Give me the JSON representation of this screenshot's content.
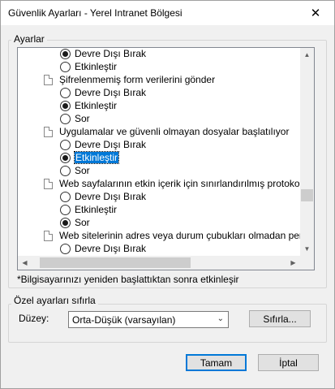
{
  "window": {
    "title": "Güvenlik Ayarları - Yerel Intranet Bölgesi",
    "close_glyph": "✕"
  },
  "settings_group": {
    "legend": "Ayarlar",
    "rows": [
      {
        "type": "radio",
        "level": 2,
        "checked": true,
        "label": "Devre Dışı Bırak"
      },
      {
        "type": "radio",
        "level": 2,
        "checked": false,
        "label": "Etkinleştir"
      },
      {
        "type": "setting",
        "level": 1,
        "label": "Şifrelenmemiş form verilerini gönder"
      },
      {
        "type": "radio",
        "level": 2,
        "checked": false,
        "label": "Devre Dışı Bırak"
      },
      {
        "type": "radio",
        "level": 2,
        "checked": true,
        "label": "Etkinleştir"
      },
      {
        "type": "radio",
        "level": 2,
        "checked": false,
        "label": "Sor"
      },
      {
        "type": "setting",
        "level": 1,
        "label": "Uygulamalar ve güvenli olmayan dosyalar başlatılıyor"
      },
      {
        "type": "radio",
        "level": 2,
        "checked": false,
        "label": "Devre Dışı Bırak"
      },
      {
        "type": "radio",
        "level": 2,
        "checked": true,
        "label": "Etkinleştir",
        "selected": true
      },
      {
        "type": "radio",
        "level": 2,
        "checked": false,
        "label": "Sor"
      },
      {
        "type": "setting",
        "level": 1,
        "label": "Web sayfalarının etkin içerik için sınırlandırılmış protokolleri kull"
      },
      {
        "type": "radio",
        "level": 2,
        "checked": false,
        "label": "Devre Dışı Bırak"
      },
      {
        "type": "radio",
        "level": 2,
        "checked": false,
        "label": "Etkinleştir"
      },
      {
        "type": "radio",
        "level": 2,
        "checked": true,
        "label": "Sor"
      },
      {
        "type": "setting",
        "level": 1,
        "label": "Web sitelerinin adres veya durum çubukları olmadan pencere"
      },
      {
        "type": "radio",
        "level": 2,
        "checked": false,
        "label": "Devre Dışı Bırak"
      }
    ],
    "note": "*Bilgisayarınızı yeniden başlattıktan sonra etkinleşir"
  },
  "custom_group": {
    "legend": "Özel ayarları sıfırla",
    "level_label": "Düzey:",
    "level_value": "Orta-Düşük (varsayılan)",
    "reset_button": "Sıfırla..."
  },
  "footer": {
    "ok_button": "Tamam",
    "cancel_button": "İptal"
  }
}
